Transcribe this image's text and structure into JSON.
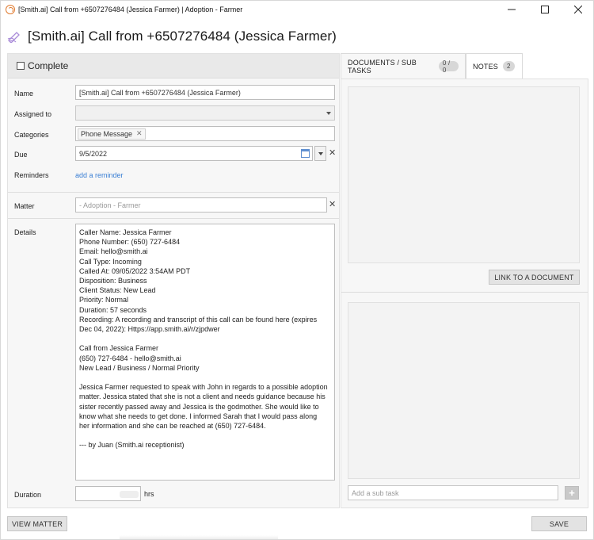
{
  "window": {
    "title": "[Smith.ai] Call from +6507276484 (Jessica Farmer) | Adoption - Farmer",
    "controls": [
      "minimize",
      "maximize",
      "close"
    ]
  },
  "header": {
    "title": "[Smith.ai] Call from +6507276484 (Jessica Farmer)",
    "icon": "pencil-task-icon"
  },
  "form": {
    "complete_label": "Complete",
    "name_label": "Name",
    "name_value": "[Smith.ai] Call from +6507276484 (Jessica Farmer)",
    "assigned_label": "Assigned to",
    "assigned_value": "",
    "categories_label": "Categories",
    "categories": [
      {
        "label": "Phone Message"
      }
    ],
    "due_label": "Due",
    "due_value": "9/5/2022",
    "reminders_label": "Reminders",
    "add_reminder_link": "add a reminder",
    "matter_label": "Matter",
    "matter_placeholder": "- Adoption - Farmer",
    "details_label": "Details",
    "details_lines": [
      "Caller Name: Jessica Farmer",
      "Phone Number: (650) 727-6484",
      "Email: hello@smith.ai",
      "Call Type: Incoming",
      "Called At: 09/05/2022 3:54AM PDT",
      "Disposition: Business",
      "Client Status: New Lead",
      "Priority: Normal",
      "Duration: 57 seconds",
      "Recording: A recording and transcript of this call can be found here (expires",
      "Dec 04, 2022): Https://app.smith.ai/r/zjpdwer",
      "",
      "Call from Jessica Farmer",
      "(650) 727-6484 - hello@smith.ai",
      "New Lead / Business / Normal Priority",
      "",
      "Jessica Farmer requested to speak with John in regards to a possible adoption",
      "matter. Jessica stated that she is not a client and needs guidance because his",
      "sister recently passed away and Jessica is the godmother. She would like to",
      "know what she needs to get done. I informed Sarah that I would pass along",
      "her information and she can be reached at (650) 727-6484.",
      "",
      "--- by Juan (Smith.ai receptionist)"
    ],
    "duration_label": "Duration",
    "duration_unit": "hrs"
  },
  "tabs": {
    "documents_label": "DOCUMENTS / SUB TASKS",
    "documents_badge": "0 / 0",
    "notes_label": "NOTES",
    "notes_badge": "2"
  },
  "right": {
    "link_document_label": "LINK TO A DOCUMENT",
    "subtask_placeholder": "Add a sub task",
    "add_label": "+"
  },
  "footer": {
    "view_matter_label": "VIEW MATTER",
    "save_label": "SAVE"
  },
  "colors": {
    "link": "#3a7fd4",
    "app_icon": "#e07a2e",
    "task_icon": "#a98bd8"
  }
}
